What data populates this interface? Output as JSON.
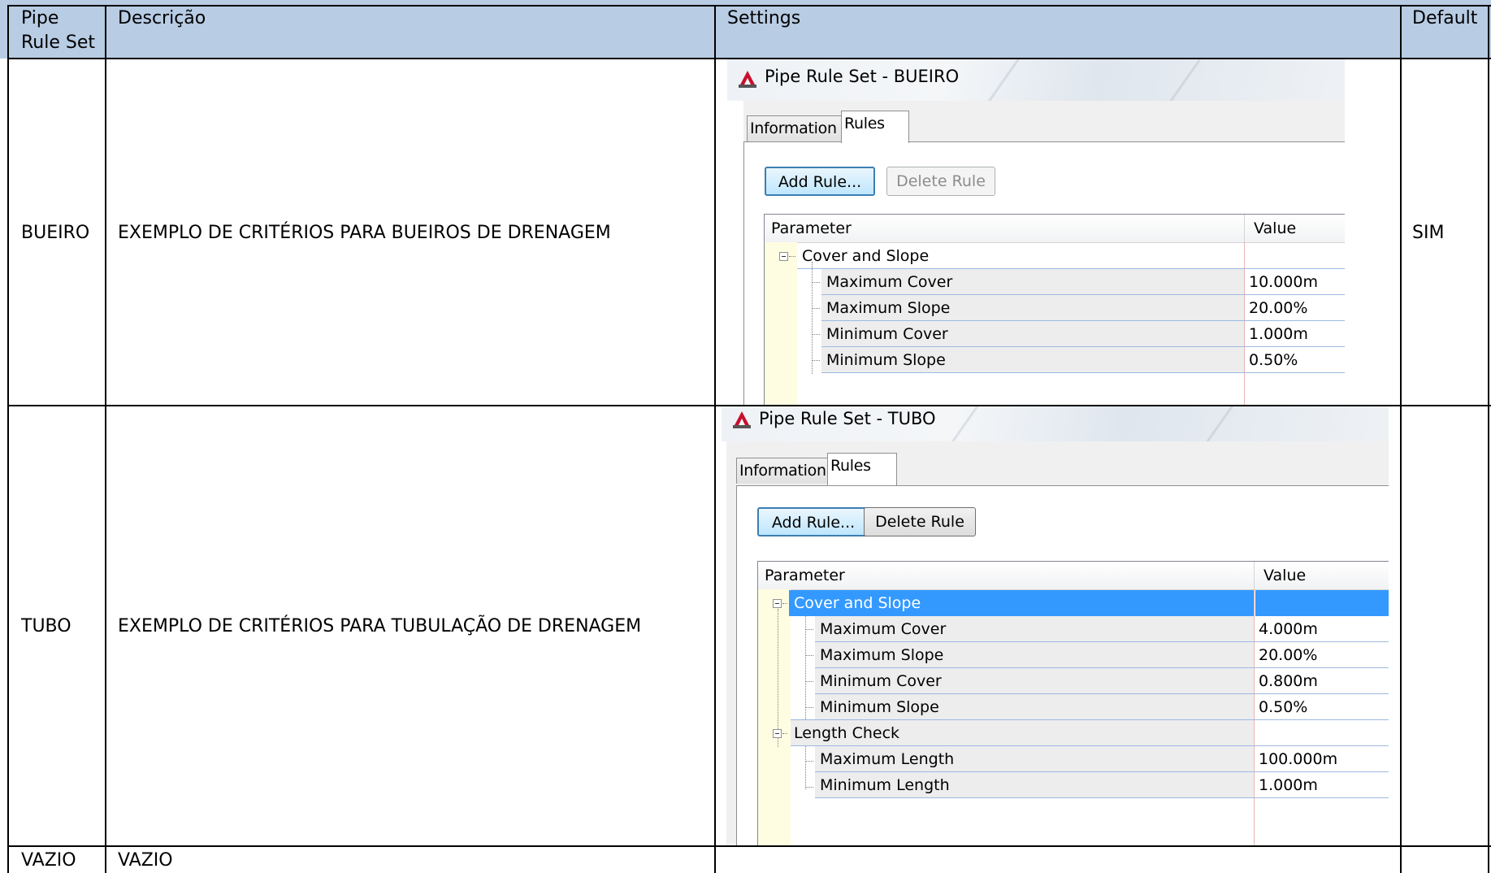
{
  "table": {
    "headers": {
      "col1": "Pipe Rule Set",
      "col2": "Descrição",
      "col3": "Settings",
      "col4": "Default"
    },
    "rows": [
      {
        "name": "BUEIRO",
        "description": "EXEMPLO DE CRITÉRIOS PARA BUEIROS DE DRENAGEM",
        "default": "SIM"
      },
      {
        "name": "TUBO",
        "description": "EXEMPLO DE CRITÉRIOS PARA TUBULAÇÃO DE DRENAGEM",
        "default": ""
      },
      {
        "name": "VAZIO",
        "description": "VAZIO",
        "default": ""
      }
    ]
  },
  "dialog_bueiro": {
    "title": "Pipe Rule Set - BUEIRO",
    "tabs": [
      "Information",
      "Rules"
    ],
    "active_tab": "Rules",
    "add_rule": "Add Rule...",
    "delete_rule": "Delete Rule",
    "delete_rule_enabled": false,
    "columns": {
      "parameter": "Parameter",
      "value": "Value"
    },
    "group": "Cover and Slope",
    "params": [
      {
        "name": "Maximum Cover",
        "value": "10.000m"
      },
      {
        "name": "Maximum Slope",
        "value": "20.00%"
      },
      {
        "name": "Minimum Cover",
        "value": "1.000m"
      },
      {
        "name": "Minimum Slope",
        "value": "0.50%"
      }
    ]
  },
  "dialog_tubo": {
    "title": "Pipe Rule Set - TUBO",
    "tabs": [
      "Information",
      "Rules"
    ],
    "active_tab": "Rules",
    "add_rule": "Add Rule...",
    "delete_rule": "Delete Rule",
    "delete_rule_enabled": true,
    "columns": {
      "parameter": "Parameter",
      "value": "Value"
    },
    "group1": "Cover and Slope",
    "group1_selected": true,
    "params1": [
      {
        "name": "Maximum Cover",
        "value": "4.000m"
      },
      {
        "name": "Maximum Slope",
        "value": "20.00%"
      },
      {
        "name": "Minimum Cover",
        "value": "0.800m"
      },
      {
        "name": "Minimum Slope",
        "value": "0.50%"
      }
    ],
    "group2": "Length Check",
    "params2": [
      {
        "name": "Maximum Length",
        "value": "100.000m"
      },
      {
        "name": "Minimum Length",
        "value": "1.000m"
      }
    ]
  },
  "colors": {
    "header_bg": "#b8cce4",
    "selection": "#3399ff"
  }
}
